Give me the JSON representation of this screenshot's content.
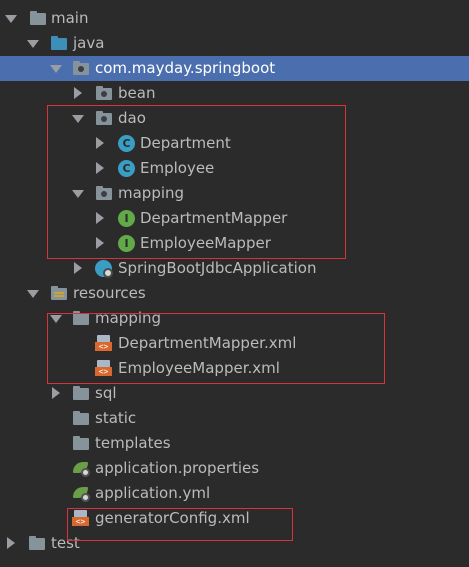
{
  "tree": {
    "items": [
      {
        "label": "main",
        "icon": "folder-icon",
        "expanded": true
      },
      {
        "label": "java",
        "icon": "source-folder-icon",
        "expanded": true
      },
      {
        "label": "com.mayday.springboot",
        "icon": "package-icon",
        "expanded": true,
        "selected": true
      },
      {
        "label": "bean",
        "icon": "package-icon",
        "expanded": false
      },
      {
        "label": "dao",
        "icon": "package-icon",
        "expanded": true
      },
      {
        "label": "Department",
        "icon": "class-icon",
        "icon_letter": "C",
        "expanded": false
      },
      {
        "label": "Employee",
        "icon": "class-icon",
        "icon_letter": "C",
        "expanded": false
      },
      {
        "label": "mapping",
        "icon": "package-icon",
        "expanded": true
      },
      {
        "label": "DepartmentMapper",
        "icon": "interface-icon",
        "icon_letter": "I",
        "expanded": false
      },
      {
        "label": "EmployeeMapper",
        "icon": "interface-icon",
        "icon_letter": "I",
        "expanded": false
      },
      {
        "label": "SpringBootJdbcApplication",
        "icon": "spring-boot-app-icon",
        "expanded": false
      },
      {
        "label": "resources",
        "icon": "resources-folder-icon",
        "expanded": true
      },
      {
        "label": "mapping",
        "icon": "folder-icon",
        "expanded": true
      },
      {
        "label": "DepartmentMapper.xml",
        "icon": "xml-file-icon"
      },
      {
        "label": "EmployeeMapper.xml",
        "icon": "xml-file-icon"
      },
      {
        "label": "sql",
        "icon": "folder-icon",
        "expanded": false
      },
      {
        "label": "static",
        "icon": "folder-icon"
      },
      {
        "label": "templates",
        "icon": "folder-icon"
      },
      {
        "label": "application.properties",
        "icon": "spring-properties-icon"
      },
      {
        "label": "application.yml",
        "icon": "spring-yml-icon"
      },
      {
        "label": "generatorConfig.xml",
        "icon": "xml-file-icon"
      },
      {
        "label": "test",
        "icon": "folder-icon",
        "expanded": false
      }
    ]
  },
  "colors": {
    "background": "#2b2b2b",
    "selection": "#4b6eaf",
    "highlight_box": "#d9323a",
    "text": "#bbbbbb"
  }
}
